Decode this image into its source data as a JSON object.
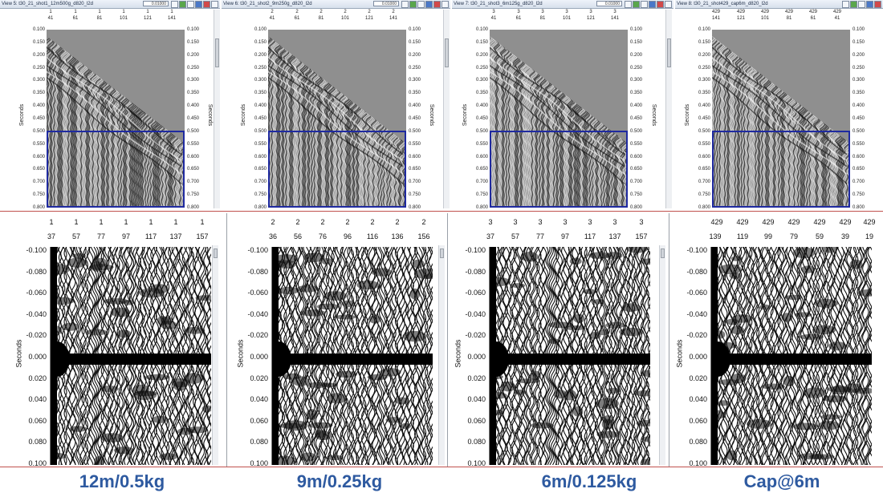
{
  "top_views": [
    {
      "title": "View 5: t30_21_shot1_12m500g_d820_l2d",
      "zoom": "0.01000",
      "tick_top": [
        "1",
        "1",
        "1",
        "1",
        "1",
        "1"
      ],
      "tick_bottom": [
        "41",
        "61",
        "81",
        "101",
        "121",
        "141"
      ],
      "y_ticks": [
        "0.100",
        "0.150",
        "0.200",
        "0.250",
        "0.300",
        "0.350",
        "0.400",
        "0.450",
        "0.500",
        "0.550",
        "0.600",
        "0.650",
        "0.700",
        "0.750",
        "0.800"
      ],
      "y_label": "Seconds"
    },
    {
      "title": "View 6: t30_21_shot2_9m250g_d820_l2d",
      "zoom": "0.01000",
      "tick_top": [
        "2",
        "2",
        "2",
        "2",
        "2",
        "2"
      ],
      "tick_bottom": [
        "41",
        "61",
        "81",
        "101",
        "121",
        "141"
      ],
      "y_ticks": [
        "0.100",
        "0.150",
        "0.200",
        "0.250",
        "0.300",
        "0.350",
        "0.400",
        "0.450",
        "0.500",
        "0.550",
        "0.600",
        "0.650",
        "0.700",
        "0.750",
        "0.800"
      ],
      "y_label": "Seconds"
    },
    {
      "title": "View 7: t30_21_shot3_6m125g_d820_l2d",
      "zoom": "0.01000",
      "tick_top": [
        "3",
        "3",
        "3",
        "3",
        "3",
        "3"
      ],
      "tick_bottom": [
        "41",
        "61",
        "81",
        "101",
        "121",
        "141"
      ],
      "y_ticks": [
        "0.100",
        "0.150",
        "0.200",
        "0.250",
        "0.300",
        "0.350",
        "0.400",
        "0.450",
        "0.500",
        "0.550",
        "0.600",
        "0.650",
        "0.700",
        "0.750",
        "0.800"
      ],
      "y_label": "Seconds"
    },
    {
      "title": "View 8: t30_21_shot429_cap6m_d820_l2d",
      "zoom": "",
      "tick_top": [
        "429",
        "429",
        "429",
        "429",
        "429",
        "429"
      ],
      "tick_bottom": [
        "141",
        "121",
        "101",
        "81",
        "61",
        "41"
      ],
      "y_ticks": [
        "0.100",
        "0.150",
        "0.200",
        "0.250",
        "0.300",
        "0.350",
        "0.400",
        "0.450",
        "0.500",
        "0.550",
        "0.600",
        "0.650",
        "0.700",
        "0.750",
        "0.800"
      ],
      "y_label": "Seconds"
    }
  ],
  "bottom_views": [
    {
      "tick_top": [
        "1",
        "1",
        "1",
        "1",
        "1",
        "1",
        "1"
      ],
      "tick_bottom": [
        "37",
        "57",
        "77",
        "97",
        "117",
        "137",
        "157"
      ],
      "y_ticks": [
        "-0.100",
        "-0.080",
        "-0.060",
        "-0.040",
        "-0.020",
        "0.000",
        "0.020",
        "0.040",
        "0.060",
        "0.080",
        "0.100"
      ],
      "y_label": "Seconds"
    },
    {
      "tick_top": [
        "2",
        "2",
        "2",
        "2",
        "2",
        "2",
        "2"
      ],
      "tick_bottom": [
        "36",
        "56",
        "76",
        "96",
        "116",
        "136",
        "156"
      ],
      "y_ticks": [
        "-0.100",
        "-0.080",
        "-0.060",
        "-0.040",
        "-0.020",
        "0.000",
        "0.020",
        "0.040",
        "0.060",
        "0.080",
        "0.100"
      ],
      "y_label": "Seconds"
    },
    {
      "tick_top": [
        "3",
        "3",
        "3",
        "3",
        "3",
        "3",
        "3"
      ],
      "tick_bottom": [
        "37",
        "57",
        "77",
        "97",
        "117",
        "137",
        "157"
      ],
      "y_ticks": [
        "-0.100",
        "-0.080",
        "-0.060",
        "-0.040",
        "-0.020",
        "0.000",
        "0.020",
        "0.040",
        "0.060",
        "0.080",
        "0.100"
      ],
      "y_label": "Seconds"
    },
    {
      "tick_top": [
        "429",
        "429",
        "429",
        "429",
        "429",
        "429",
        "429"
      ],
      "tick_bottom": [
        "139",
        "119",
        "99",
        "79",
        "59",
        "39",
        "19"
      ],
      "y_ticks": [
        "-0.100",
        "-0.080",
        "-0.060",
        "-0.040",
        "-0.020",
        "0.000",
        "0.020",
        "0.040",
        "0.060",
        "0.080",
        "0.100"
      ],
      "y_label": "Seconds"
    }
  ],
  "captions": [
    "12m/0.5kg",
    "9m/0.25kg",
    "6m/0.125kg",
    "Cap@6m"
  ],
  "colors": {
    "caption": "#2e5aa0",
    "selection": "#1f2aa0",
    "divider": "#c0504d"
  }
}
